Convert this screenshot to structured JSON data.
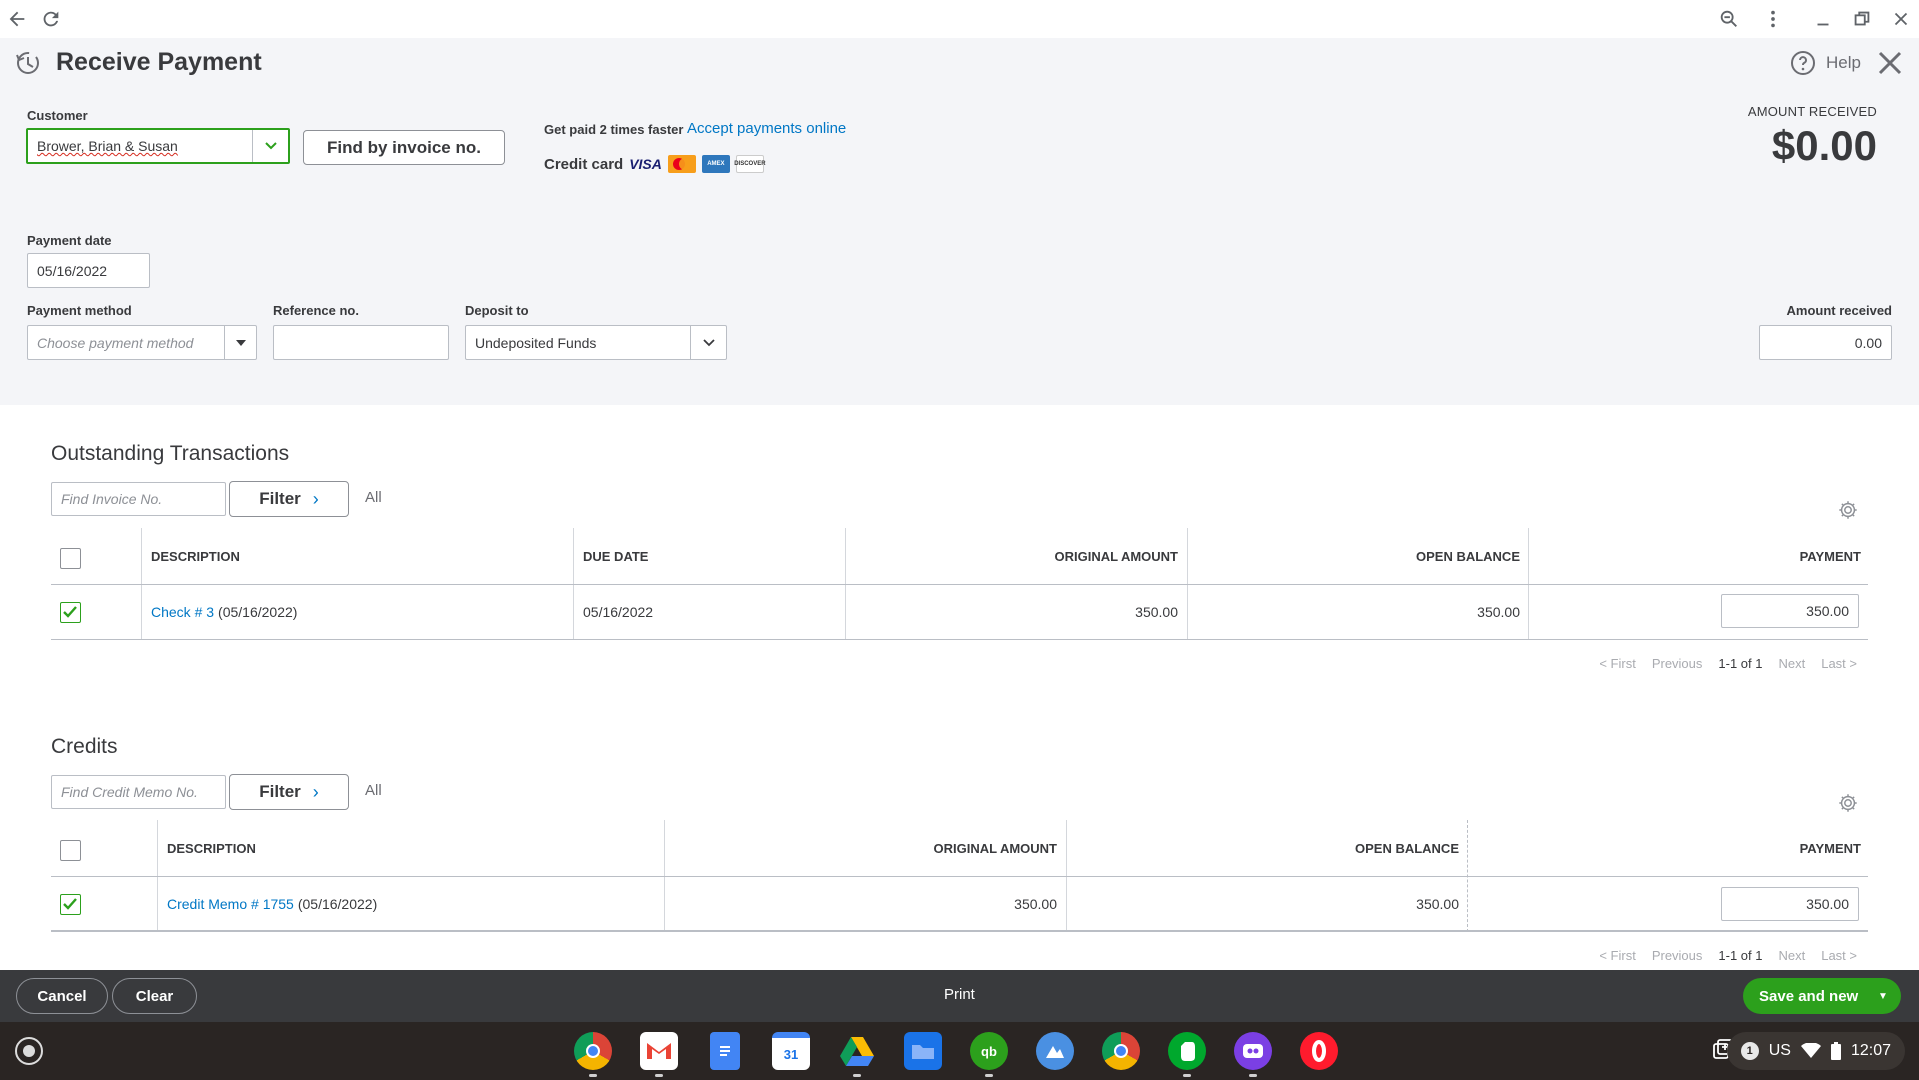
{
  "page": {
    "title": "Receive Payment",
    "help_label": "Help"
  },
  "customer": {
    "label": "Customer",
    "value": "Brower, Brian & Susan",
    "find_by_invoice_label": "Find by invoice no."
  },
  "promo": {
    "text": "Get paid 2 times faster",
    "link": "Accept payments online",
    "credit_card_label": "Credit card",
    "visa": "VISA",
    "mastercard": "MasterCard",
    "amex": "AMEX",
    "discover": "DISCOVER"
  },
  "amount_received_summary": {
    "label": "AMOUNT RECEIVED",
    "value": "$0.00"
  },
  "payment_date": {
    "label": "Payment date",
    "value": "05/16/2022"
  },
  "payment_method": {
    "label": "Payment method",
    "placeholder": "Choose payment method"
  },
  "reference_no": {
    "label": "Reference no.",
    "value": ""
  },
  "deposit_to": {
    "label": "Deposit to",
    "value": "Undeposited Funds"
  },
  "amount_received": {
    "label": "Amount received",
    "value": "0.00"
  },
  "outstanding": {
    "title": "Outstanding Transactions",
    "find_placeholder": "Find Invoice No.",
    "filter_label": "Filter",
    "all_label": "All",
    "columns": [
      "DESCRIPTION",
      "DUE DATE",
      "ORIGINAL AMOUNT",
      "OPEN BALANCE",
      "PAYMENT"
    ],
    "rows": [
      {
        "checked": true,
        "link": "Check # 3",
        "date_suffix": "(05/16/2022)",
        "due_date": "05/16/2022",
        "original_amount": "350.00",
        "open_balance": "350.00",
        "payment": "350.00"
      }
    ],
    "pager": {
      "first": "< First",
      "previous": "Previous",
      "range": "1-1 of 1",
      "next": "Next",
      "last": "Last >"
    }
  },
  "credits": {
    "title": "Credits",
    "find_placeholder": "Find Credit Memo No.",
    "filter_label": "Filter",
    "all_label": "All",
    "columns": [
      "DESCRIPTION",
      "ORIGINAL AMOUNT",
      "OPEN BALANCE",
      "PAYMENT"
    ],
    "rows": [
      {
        "checked": true,
        "link": "Credit Memo # 1755",
        "date_suffix": "(05/16/2022)",
        "original_amount": "350.00",
        "open_balance": "350.00",
        "payment": "350.00"
      }
    ],
    "pager": {
      "first": "< First",
      "previous": "Previous",
      "range": "1-1 of 1",
      "next": "Next",
      "last": "Last >"
    }
  },
  "footer": {
    "cancel_label": "Cancel",
    "clear_label": "Clear",
    "print_label": "Print",
    "save_label": "Save and new"
  },
  "shelf": {
    "apps": [
      "chrome-icon",
      "gmail-icon",
      "docs-icon",
      "calendar-icon",
      "drive-icon",
      "files-icon",
      "quickbooks-icon",
      "app-icon",
      "chrome-icon",
      "evernote-icon",
      "app-icon",
      "opera-icon"
    ],
    "calendar_day": "31",
    "notification_count": "1",
    "locale": "US",
    "time": "12:07"
  },
  "colors": {
    "accent_link": "#0077c5",
    "success_green": "#2ca01c",
    "footer_bg": "#393a3d",
    "form_bg": "#f4f5f8"
  }
}
